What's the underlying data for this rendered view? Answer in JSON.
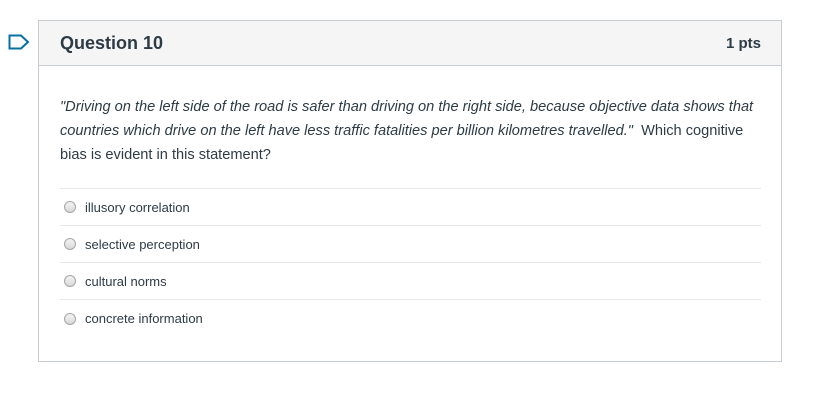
{
  "question": {
    "title": "Question 10",
    "points": "1 pts",
    "text_italic": "\"Driving on the left side of the road is safer than driving on the right side, because objective data shows that countries which drive on the left have less traffic fatalities per billion kilometres travelled.\"",
    "text_plain": "  Which cognitive bias is evident in this statement?"
  },
  "answers": [
    {
      "label": "illusory correlation"
    },
    {
      "label": "selective perception"
    },
    {
      "label": "cultural norms"
    },
    {
      "label": "concrete information"
    }
  ],
  "colors": {
    "flag": "#0770a3",
    "header_bg": "#f5f5f5",
    "border": "#c7cdd1",
    "text": "#2d3b45"
  },
  "icons": {
    "flag": "bookmark-flag-icon"
  }
}
